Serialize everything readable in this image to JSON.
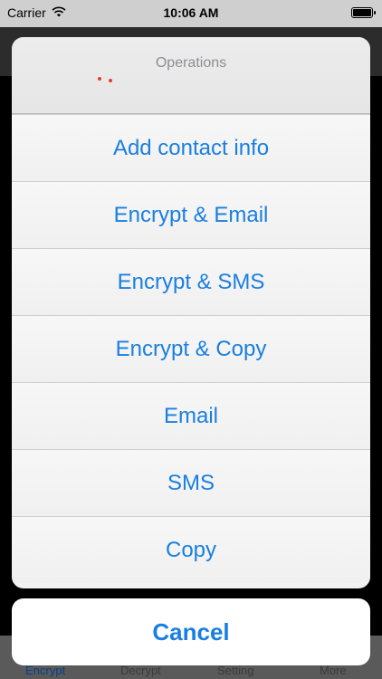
{
  "status_bar": {
    "carrier": "Carrier",
    "time": "10:06 AM"
  },
  "action_sheet": {
    "title": "Operations",
    "items": [
      "Add contact info",
      "Encrypt & Email",
      "Encrypt & SMS",
      "Encrypt & Copy",
      "Email",
      "SMS",
      "Copy"
    ],
    "cancel_label": "Cancel"
  },
  "tab_bar": {
    "tabs": [
      "Encrypt",
      "Decrypt",
      "Setting",
      "More"
    ],
    "active_index": 0
  },
  "colors": {
    "action_blue": "#1a7fe0",
    "title_gray": "#8e8e93"
  },
  "icons": [
    "wifi-icon",
    "battery-icon"
  ]
}
